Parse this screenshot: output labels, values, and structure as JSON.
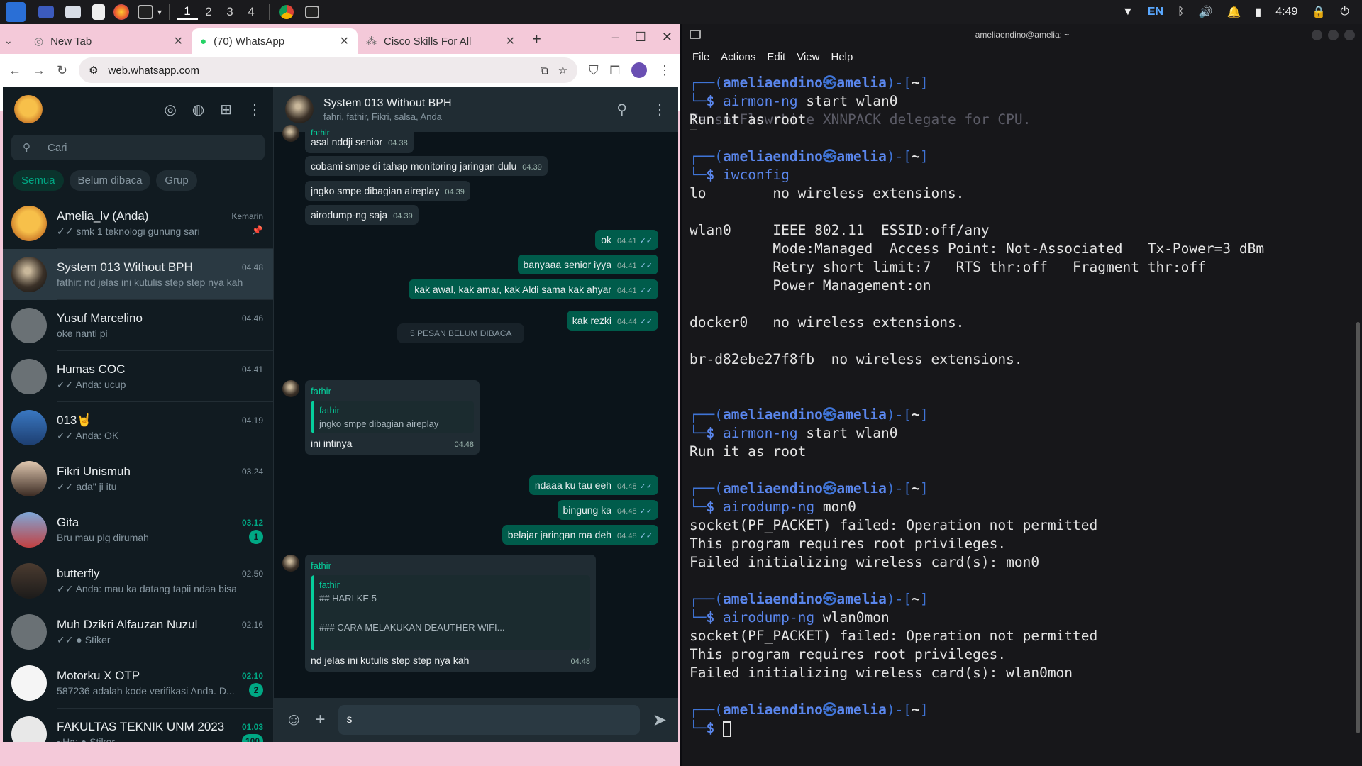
{
  "taskbar": {
    "workspaces": [
      "1",
      "2",
      "3",
      "4"
    ],
    "lang": "EN",
    "time": "4:49"
  },
  "chrome": {
    "tabs": [
      {
        "title": "New Tab"
      },
      {
        "title": "(70) WhatsApp"
      },
      {
        "title": "Cisco Skills For All"
      }
    ],
    "url": "web.whatsapp.com"
  },
  "wa": {
    "search_placeholder": "Cari",
    "filters": [
      "Semua",
      "Belum dibaca",
      "Grup"
    ],
    "chats": [
      {
        "name": "Amelia_lv (Anda)",
        "time": "Kemarin",
        "msg": "✓✓ smk 1 teknologi gunung sari",
        "time_color": "grey",
        "badge": "",
        "pinned": true
      },
      {
        "name": "System 013 Without BPH",
        "time": "04.48",
        "msg": "fathir: nd jelas ini kutulis step step nya kah",
        "time_color": "grey",
        "badge": "",
        "selected": true
      },
      {
        "name": "Yusuf Marcelino",
        "time": "04.46",
        "msg": "oke nanti pi",
        "time_color": "grey",
        "badge": ""
      },
      {
        "name": "Humas COC",
        "time": "04.41",
        "msg": "✓✓ Anda: ucup",
        "time_color": "grey",
        "badge": ""
      },
      {
        "name": "013🤘",
        "time": "04.19",
        "msg": "✓✓ Anda: OK",
        "time_color": "grey",
        "badge": ""
      },
      {
        "name": "Fikri Unismuh",
        "time": "03.24",
        "msg": "✓✓ ada\" ji itu",
        "time_color": "grey",
        "badge": ""
      },
      {
        "name": "Gita",
        "time": "03.12",
        "msg": "Bru mau plg dirumah",
        "time_color": "green",
        "badge": "1"
      },
      {
        "name": "butterfly",
        "time": "02.50",
        "msg": "✓✓ Anda: mau ka datang tapii ndaa bisa",
        "time_color": "grey",
        "badge": ""
      },
      {
        "name": "Muh Dzikri Alfauzan Nuzul",
        "time": "02.16",
        "msg": "✓✓ ● Stiker",
        "time_color": "grey",
        "badge": ""
      },
      {
        "name": "Motorku X OTP",
        "time": "02.10",
        "msg": "587236 adalah kode verifikasi Anda. D...",
        "time_color": "green",
        "badge": "2"
      },
      {
        "name": "FAKULTAS TEKNIK UNM 2023",
        "time": "01.03",
        "msg": "~Ha: ● Stiker",
        "time_color": "green",
        "badge": "100"
      }
    ],
    "chat": {
      "name": "System 013 Without BPH",
      "members": "fahri, fathir, Fikri, salsa, Anda",
      "top_sender": "fathir",
      "messages_in_1": [
        {
          "text": "asal nddji senior",
          "time": "04.38"
        },
        {
          "text": "cobami smpe di tahap monitoring jaringan dulu",
          "time": "04.39"
        },
        {
          "text": "jngko smpe dibagian aireplay",
          "time": "04.39"
        },
        {
          "text": "airodump-ng saja",
          "time": "04.39"
        }
      ],
      "messages_out_1": [
        {
          "text": "ok",
          "time": "04.41"
        },
        {
          "text": "banyaaa senior iyya",
          "time": "04.41"
        },
        {
          "text": "kak awal, kak amar, kak Aldi sama kak ahyar",
          "time": "04.41"
        },
        {
          "text": "kak rezki",
          "time": "04.44"
        }
      ],
      "unread_label": "5 PESAN BELUM DIBACA",
      "reply1": {
        "sender": "fathir",
        "quote_sender": "fathir",
        "quote_text": "jngko smpe dibagian aireplay",
        "text": "ini intinya",
        "time": "04.48"
      },
      "messages_out_2": [
        {
          "text": "ndaaa ku tau eeh",
          "time": "04.48"
        },
        {
          "text": "bingung ka",
          "time": "04.48"
        },
        {
          "text": "belajar jaringan ma deh",
          "time": "04.48"
        }
      ],
      "reply2": {
        "sender": "fathir",
        "quote_sender": "fathir",
        "quote_line1": "## HARI KE 5",
        "quote_line2": "### CARA MELAKUKAN DEAUTHER WIFI...",
        "text": "nd jelas ini kutulis step step nya kah",
        "time": "04.48"
      },
      "input_value": "s"
    }
  },
  "terminal": {
    "title": "ameliaendino@amelia: ~",
    "menu": [
      "File",
      "Actions",
      "Edit",
      "View",
      "Help"
    ],
    "user": "ameliaendino",
    "host": "amelia",
    "dir": "~",
    "cmd1": "airmon-ng",
    "cmd1_args": " start wlan0",
    "out1a": "Run it as root",
    "out1_ghost": "TensorFlow Lite XNNPACK delegate for CPU.",
    "cmd2": "iwconfig",
    "iw": [
      "lo        no wireless extensions.",
      "",
      "wlan0     IEEE 802.11  ESSID:off/any",
      "          Mode:Managed  Access Point: Not-Associated   Tx-Power=3 dBm",
      "          Retry short limit:7   RTS thr:off   Fragment thr:off",
      "          Power Management:on",
      "",
      "docker0   no wireless extensions.",
      "",
      "br-d82ebe27f8fb  no wireless extensions.",
      "",
      ""
    ],
    "cmd3": "airmon-ng",
    "cmd3_args": " start wlan0",
    "out3": "Run it as root",
    "cmd4": "airodump-ng",
    "cmd4_args": " mon0",
    "out4": [
      "socket(PF_PACKET) failed: Operation not permitted",
      "This program requires root privileges.",
      "Failed initializing wireless card(s): mon0"
    ],
    "cmd5": "airodump-ng",
    "cmd5_args": " wlan0mon",
    "out5": [
      "socket(PF_PACKET) failed: Operation not permitted",
      "This program requires root privileges.",
      "Failed initializing wireless card(s): wlan0mon"
    ]
  }
}
